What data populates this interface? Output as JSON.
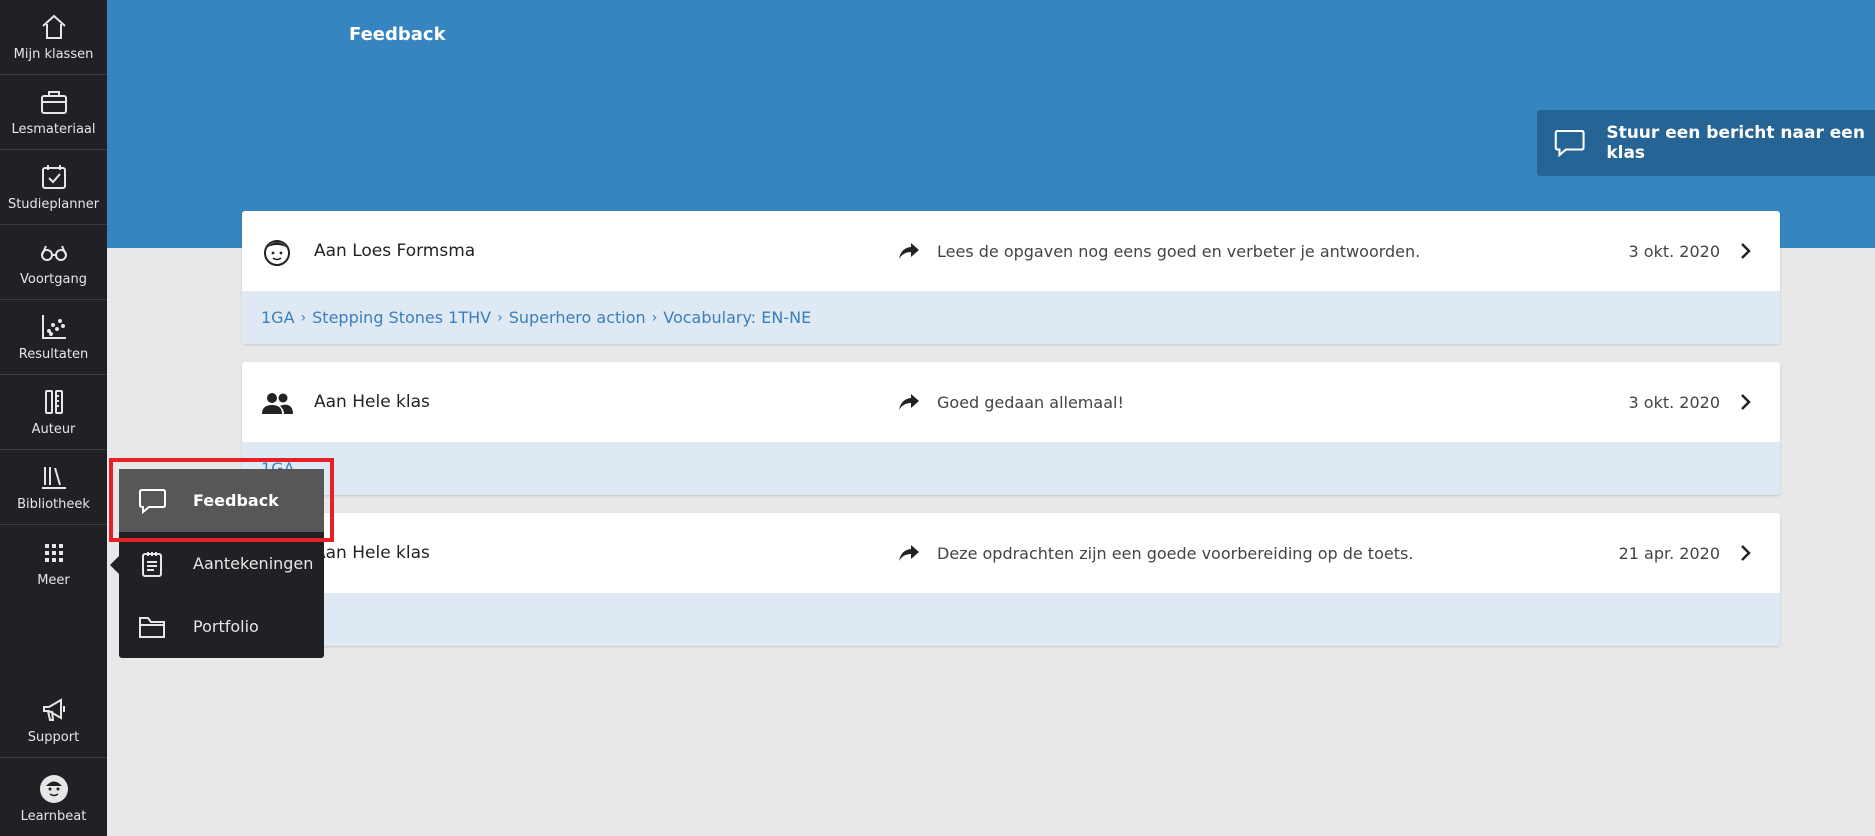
{
  "sidebar": {
    "items": [
      {
        "label": "Mijn klassen",
        "icon": "home-icon"
      },
      {
        "label": "Lesmateriaal",
        "icon": "briefcase-icon"
      },
      {
        "label": "Studieplanner",
        "icon": "calendar-check-icon"
      },
      {
        "label": "Voortgang",
        "icon": "glasses-icon"
      },
      {
        "label": "Resultaten",
        "icon": "scatter-chart-icon"
      },
      {
        "label": "Auteur",
        "icon": "author-tools-icon"
      },
      {
        "label": "Bibliotheek",
        "icon": "library-icon"
      },
      {
        "label": "Meer",
        "icon": "grid-icon"
      }
    ],
    "support_label": "Support",
    "learnbeat_label": "Learnbeat"
  },
  "header": {
    "title": "Feedback",
    "send_button_label": "Stuur een bericht naar een klas"
  },
  "cards": [
    {
      "to": "Aan Loes Formsma",
      "message": "Lees de opgaven nog eens goed en verbeter je antwoorden.",
      "date": "3 okt. 2020",
      "breadcrumb": [
        "1GA",
        "Stepping Stones 1THV",
        "Superhero action",
        "Vocabulary: EN-NE"
      ]
    },
    {
      "to": "Aan Hele klas",
      "message": "Goed gedaan allemaal!",
      "date": "3 okt. 2020",
      "breadcrumb": [
        "1GA"
      ]
    },
    {
      "to": "Aan Hele klas",
      "message": "Deze opdrachten zijn een goede voorbereiding op de toets.",
      "date": "21 apr. 2020",
      "breadcrumb": []
    }
  ],
  "popup_menu": {
    "items": [
      {
        "label": "Feedback",
        "icon": "speech-bubble-icon",
        "active": true
      },
      {
        "label": "Aantekeningen",
        "icon": "notepad-icon",
        "active": false
      },
      {
        "label": "Portfolio",
        "icon": "folder-icon",
        "active": false
      }
    ]
  },
  "colors": {
    "header_blue": "#3684c0",
    "button_dark_blue": "#276496",
    "sidebar_dark": "#1f2124",
    "link_blue": "#3a7fbd",
    "highlight_red": "#e52027"
  }
}
